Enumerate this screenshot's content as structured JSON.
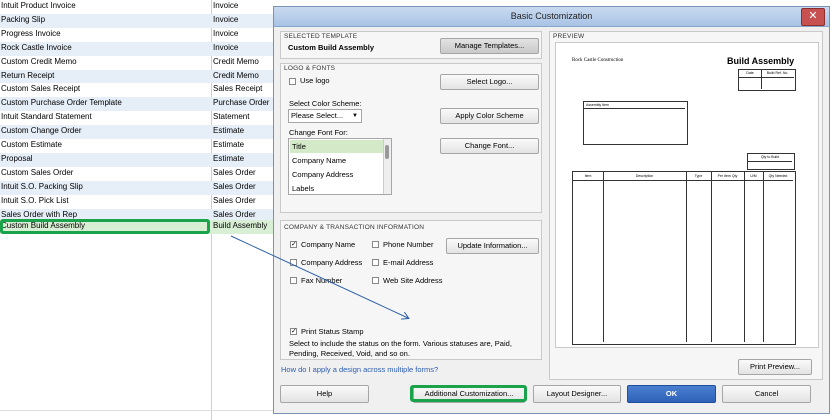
{
  "templates": [
    {
      "name": "Intuit Product Invoice",
      "type": "Invoice"
    },
    {
      "name": "Packing Slip",
      "type": "Invoice"
    },
    {
      "name": "Progress Invoice",
      "type": "Invoice"
    },
    {
      "name": "Rock Castle Invoice",
      "type": "Invoice"
    },
    {
      "name": "Custom Credit Memo",
      "type": "Credit Memo"
    },
    {
      "name": "Return Receipt",
      "type": "Credit Memo"
    },
    {
      "name": "Custom Sales Receipt",
      "type": "Sales Receipt"
    },
    {
      "name": "Custom Purchase Order Template",
      "type": "Purchase Order"
    },
    {
      "name": "Intuit Standard Statement",
      "type": "Statement"
    },
    {
      "name": "Custom Change Order",
      "type": "Estimate"
    },
    {
      "name": "Custom Estimate",
      "type": "Estimate"
    },
    {
      "name": "Proposal",
      "type": "Estimate"
    },
    {
      "name": "Custom Sales Order",
      "type": "Sales Order"
    },
    {
      "name": "Intuit S.O. Packing Slip",
      "type": "Sales Order"
    },
    {
      "name": "Intuit S.O. Pick List",
      "type": "Sales Order"
    },
    {
      "name": "Sales Order with Rep",
      "type": "Sales Order"
    },
    {
      "name": "Custom Build Assembly",
      "type": "Build Assembly"
    }
  ],
  "dialog": {
    "title": "Basic Customization",
    "close_glyph": "✕",
    "selected_template": {
      "heading": "SELECTED TEMPLATE",
      "name": "Custom Build Assembly",
      "manage_button": "Manage Templates..."
    },
    "logo_fonts": {
      "heading": "LOGO & FONTS",
      "use_logo": "Use logo",
      "select_logo_button": "Select Logo...",
      "color_scheme_label": "Select Color Scheme:",
      "color_scheme_value": "Please Select...",
      "apply_color_button": "Apply Color Scheme",
      "change_font_label": "Change Font For:",
      "font_items": [
        "Title",
        "Company Name",
        "Company Address",
        "Labels"
      ],
      "change_font_button": "Change Font..."
    },
    "company_info": {
      "heading": "COMPANY & TRANSACTION INFORMATION",
      "company_name": "Company Name",
      "phone_number": "Phone Number",
      "company_address": "Company Address",
      "email_address": "E-mail Address",
      "fax_number": "Fax Number",
      "web_site": "Web Site Address",
      "update_button": "Update Information...",
      "print_status": "Print Status Stamp",
      "status_desc": "Select to include the status on the form. Various statuses are, Paid, Pending, Received, Void, and so on."
    },
    "help_link": "How do I apply a design across multiple forms?",
    "preview": {
      "heading": "PREVIEW",
      "company": "Rock Castle Construction",
      "doc_title": "Build Assembly",
      "date_col": "Date",
      "build_ref_col": "Build Ref. No.",
      "assembly_item": "Assembly Item",
      "qty_to_build": "Qty to Build",
      "columns": [
        "Item",
        "Description",
        "Type",
        "Per Item Qty",
        "U/M",
        "Qty Needed"
      ],
      "print_preview_button": "Print Preview..."
    },
    "buttons": {
      "help": "Help",
      "additional": "Additional Customization...",
      "layout": "Layout Designer...",
      "ok": "OK",
      "cancel": "Cancel"
    }
  }
}
